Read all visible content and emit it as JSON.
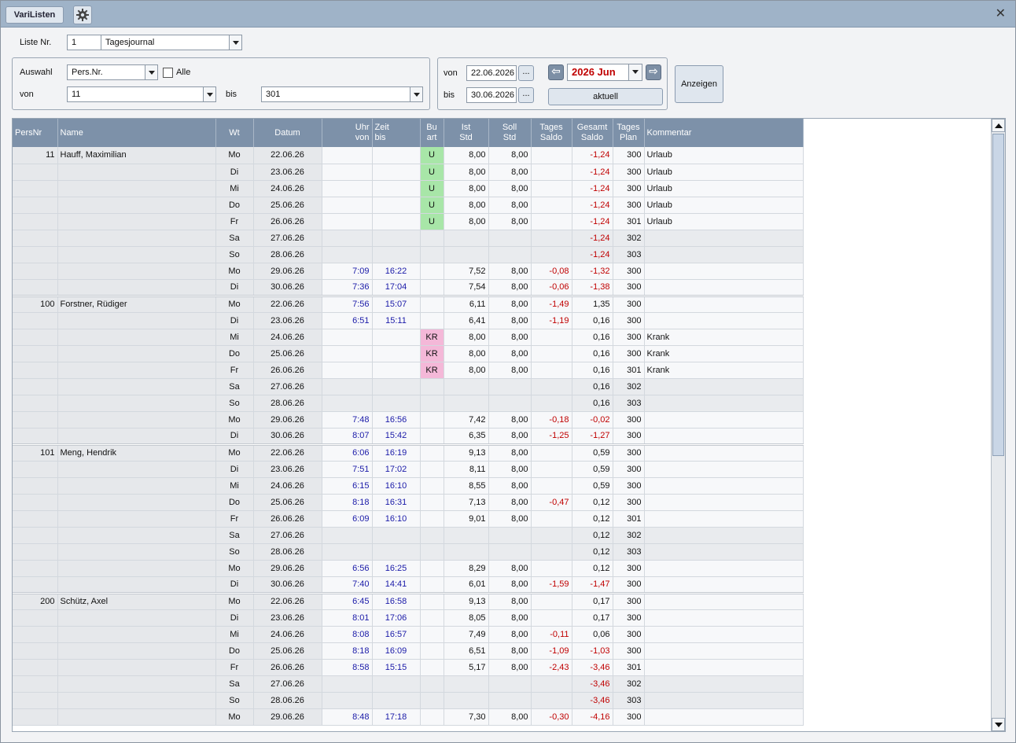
{
  "title_button": "VariListen",
  "icons": {
    "settings": "gear-icon",
    "close": "close-icon",
    "prev": "arrow-left-icon",
    "next": "arrow-right-icon"
  },
  "liste": {
    "label": "Liste Nr.",
    "nr": "1",
    "name": "Tagesjournal"
  },
  "auswahl": {
    "label": "Auswahl",
    "value": "Pers.Nr.",
    "alle_label": "Alle",
    "von_label": "von",
    "von_value": "11",
    "bis_label": "bis",
    "bis_value": "301"
  },
  "zeitraum": {
    "von_label": "von",
    "von_value": "22.06.2026",
    "bis_label": "bis",
    "bis_value": "30.06.2026",
    "ellipsis": "...",
    "month": "2026 Jun",
    "aktuell": "aktuell"
  },
  "anzeigen": "Anzeigen",
  "colors": {
    "titlebar": "#9fb3c8",
    "header": "#7d91a9",
    "urlaub": "#a8e6a8",
    "krank": "#f4b8d8",
    "negative": "#c00000",
    "time": "#1a1aa8"
  },
  "columns": [
    {
      "l1": "PersNr",
      "l2": ""
    },
    {
      "l1": "Name",
      "l2": ""
    },
    {
      "l1": "Wt",
      "l2": ""
    },
    {
      "l1": "Datum",
      "l2": ""
    },
    {
      "l1": "Uhr",
      "l2": "von"
    },
    {
      "l1": "Zeit",
      "l2": "bis"
    },
    {
      "l1": "Bu",
      "l2": "art"
    },
    {
      "l1": "Ist",
      "l2": "Std"
    },
    {
      "l1": "Soll",
      "l2": "Std"
    },
    {
      "l1": "Tages",
      "l2": "Saldo"
    },
    {
      "l1": "Gesamt",
      "l2": "Saldo"
    },
    {
      "l1": "Tages",
      "l2": "Plan"
    },
    {
      "l1": "Kommentar",
      "l2": ""
    }
  ],
  "rows": [
    {
      "pers": "11",
      "name": "Hauff, Maximilian",
      "wt": "Mo",
      "datum": "22.06.26",
      "von": "",
      "bis": "",
      "ba": "U",
      "ist": "8,00",
      "soll": "8,00",
      "ts": "",
      "gs": "-1,24",
      "plan": "300",
      "kom": "Urlaub"
    },
    {
      "pers": "",
      "name": "",
      "wt": "Di",
      "datum": "23.06.26",
      "von": "",
      "bis": "",
      "ba": "U",
      "ist": "8,00",
      "soll": "8,00",
      "ts": "",
      "gs": "-1,24",
      "plan": "300",
      "kom": "Urlaub"
    },
    {
      "pers": "",
      "name": "",
      "wt": "Mi",
      "datum": "24.06.26",
      "von": "",
      "bis": "",
      "ba": "U",
      "ist": "8,00",
      "soll": "8,00",
      "ts": "",
      "gs": "-1,24",
      "plan": "300",
      "kom": "Urlaub"
    },
    {
      "pers": "",
      "name": "",
      "wt": "Do",
      "datum": "25.06.26",
      "von": "",
      "bis": "",
      "ba": "U",
      "ist": "8,00",
      "soll": "8,00",
      "ts": "",
      "gs": "-1,24",
      "plan": "300",
      "kom": "Urlaub"
    },
    {
      "pers": "",
      "name": "",
      "wt": "Fr",
      "datum": "26.06.26",
      "von": "",
      "bis": "",
      "ba": "U",
      "ist": "8,00",
      "soll": "8,00",
      "ts": "",
      "gs": "-1,24",
      "plan": "301",
      "kom": "Urlaub"
    },
    {
      "pers": "",
      "name": "",
      "wt": "Sa",
      "datum": "27.06.26",
      "von": "",
      "bis": "",
      "ba": "",
      "ist": "",
      "soll": "",
      "ts": "",
      "gs": "-1,24",
      "plan": "302",
      "kom": ""
    },
    {
      "pers": "",
      "name": "",
      "wt": "So",
      "datum": "28.06.26",
      "von": "",
      "bis": "",
      "ba": "",
      "ist": "",
      "soll": "",
      "ts": "",
      "gs": "-1,24",
      "plan": "303",
      "kom": ""
    },
    {
      "pers": "",
      "name": "",
      "wt": "Mo",
      "datum": "29.06.26",
      "von": "7:09",
      "bis": "16:22",
      "ba": "",
      "ist": "7,52",
      "soll": "8,00",
      "ts": "-0,08",
      "gs": "-1,32",
      "plan": "300",
      "kom": ""
    },
    {
      "pers": "",
      "name": "",
      "wt": "Di",
      "datum": "30.06.26",
      "von": "7:36",
      "bis": "17:04",
      "ba": "",
      "ist": "7,54",
      "soll": "8,00",
      "ts": "-0,06",
      "gs": "-1,38",
      "plan": "300",
      "kom": ""
    },
    {
      "pers": "100",
      "name": "Forstner, Rüdiger",
      "wt": "Mo",
      "datum": "22.06.26",
      "von": "7:56",
      "bis": "15:07",
      "ba": "",
      "ist": "6,11",
      "soll": "8,00",
      "ts": "-1,49",
      "gs": "1,35",
      "plan": "300",
      "kom": ""
    },
    {
      "pers": "",
      "name": "",
      "wt": "Di",
      "datum": "23.06.26",
      "von": "6:51",
      "bis": "15:11",
      "ba": "",
      "ist": "6,41",
      "soll": "8,00",
      "ts": "-1,19",
      "gs": "0,16",
      "plan": "300",
      "kom": ""
    },
    {
      "pers": "",
      "name": "",
      "wt": "Mi",
      "datum": "24.06.26",
      "von": "",
      "bis": "",
      "ba": "KR",
      "ist": "8,00",
      "soll": "8,00",
      "ts": "",
      "gs": "0,16",
      "plan": "300",
      "kom": "Krank"
    },
    {
      "pers": "",
      "name": "",
      "wt": "Do",
      "datum": "25.06.26",
      "von": "",
      "bis": "",
      "ba": "KR",
      "ist": "8,00",
      "soll": "8,00",
      "ts": "",
      "gs": "0,16",
      "plan": "300",
      "kom": "Krank"
    },
    {
      "pers": "",
      "name": "",
      "wt": "Fr",
      "datum": "26.06.26",
      "von": "",
      "bis": "",
      "ba": "KR",
      "ist": "8,00",
      "soll": "8,00",
      "ts": "",
      "gs": "0,16",
      "plan": "301",
      "kom": "Krank"
    },
    {
      "pers": "",
      "name": "",
      "wt": "Sa",
      "datum": "27.06.26",
      "von": "",
      "bis": "",
      "ba": "",
      "ist": "",
      "soll": "",
      "ts": "",
      "gs": "0,16",
      "plan": "302",
      "kom": ""
    },
    {
      "pers": "",
      "name": "",
      "wt": "So",
      "datum": "28.06.26",
      "von": "",
      "bis": "",
      "ba": "",
      "ist": "",
      "soll": "",
      "ts": "",
      "gs": "0,16",
      "plan": "303",
      "kom": ""
    },
    {
      "pers": "",
      "name": "",
      "wt": "Mo",
      "datum": "29.06.26",
      "von": "7:48",
      "bis": "16:56",
      "ba": "",
      "ist": "7,42",
      "soll": "8,00",
      "ts": "-0,18",
      "gs": "-0,02",
      "plan": "300",
      "kom": ""
    },
    {
      "pers": "",
      "name": "",
      "wt": "Di",
      "datum": "30.06.26",
      "von": "8:07",
      "bis": "15:42",
      "ba": "",
      "ist": "6,35",
      "soll": "8,00",
      "ts": "-1,25",
      "gs": "-1,27",
      "plan": "300",
      "kom": ""
    },
    {
      "pers": "101",
      "name": "Meng, Hendrik",
      "wt": "Mo",
      "datum": "22.06.26",
      "von": "6:06",
      "bis": "16:19",
      "ba": "",
      "ist": "9,13",
      "soll": "8,00",
      "ts": "",
      "gs": "0,59",
      "plan": "300",
      "kom": ""
    },
    {
      "pers": "",
      "name": "",
      "wt": "Di",
      "datum": "23.06.26",
      "von": "7:51",
      "bis": "17:02",
      "ba": "",
      "ist": "8,11",
      "soll": "8,00",
      "ts": "",
      "gs": "0,59",
      "plan": "300",
      "kom": ""
    },
    {
      "pers": "",
      "name": "",
      "wt": "Mi",
      "datum": "24.06.26",
      "von": "6:15",
      "bis": "16:10",
      "ba": "",
      "ist": "8,55",
      "soll": "8,00",
      "ts": "",
      "gs": "0,59",
      "plan": "300",
      "kom": ""
    },
    {
      "pers": "",
      "name": "",
      "wt": "Do",
      "datum": "25.06.26",
      "von": "8:18",
      "bis": "16:31",
      "ba": "",
      "ist": "7,13",
      "soll": "8,00",
      "ts": "-0,47",
      "gs": "0,12",
      "plan": "300",
      "kom": ""
    },
    {
      "pers": "",
      "name": "",
      "wt": "Fr",
      "datum": "26.06.26",
      "von": "6:09",
      "bis": "16:10",
      "ba": "",
      "ist": "9,01",
      "soll": "8,00",
      "ts": "",
      "gs": "0,12",
      "plan": "301",
      "kom": ""
    },
    {
      "pers": "",
      "name": "",
      "wt": "Sa",
      "datum": "27.06.26",
      "von": "",
      "bis": "",
      "ba": "",
      "ist": "",
      "soll": "",
      "ts": "",
      "gs": "0,12",
      "plan": "302",
      "kom": ""
    },
    {
      "pers": "",
      "name": "",
      "wt": "So",
      "datum": "28.06.26",
      "von": "",
      "bis": "",
      "ba": "",
      "ist": "",
      "soll": "",
      "ts": "",
      "gs": "0,12",
      "plan": "303",
      "kom": ""
    },
    {
      "pers": "",
      "name": "",
      "wt": "Mo",
      "datum": "29.06.26",
      "von": "6:56",
      "bis": "16:25",
      "ba": "",
      "ist": "8,29",
      "soll": "8,00",
      "ts": "",
      "gs": "0,12",
      "plan": "300",
      "kom": ""
    },
    {
      "pers": "",
      "name": "",
      "wt": "Di",
      "datum": "30.06.26",
      "von": "7:40",
      "bis": "14:41",
      "ba": "",
      "ist": "6,01",
      "soll": "8,00",
      "ts": "-1,59",
      "gs": "-1,47",
      "plan": "300",
      "kom": ""
    },
    {
      "pers": "200",
      "name": "Schütz, Axel",
      "wt": "Mo",
      "datum": "22.06.26",
      "von": "6:45",
      "bis": "16:58",
      "ba": "",
      "ist": "9,13",
      "soll": "8,00",
      "ts": "",
      "gs": "0,17",
      "plan": "300",
      "kom": ""
    },
    {
      "pers": "",
      "name": "",
      "wt": "Di",
      "datum": "23.06.26",
      "von": "8:01",
      "bis": "17:06",
      "ba": "",
      "ist": "8,05",
      "soll": "8,00",
      "ts": "",
      "gs": "0,17",
      "plan": "300",
      "kom": ""
    },
    {
      "pers": "",
      "name": "",
      "wt": "Mi",
      "datum": "24.06.26",
      "von": "8:08",
      "bis": "16:57",
      "ba": "",
      "ist": "7,49",
      "soll": "8,00",
      "ts": "-0,11",
      "gs": "0,06",
      "plan": "300",
      "kom": ""
    },
    {
      "pers": "",
      "name": "",
      "wt": "Do",
      "datum": "25.06.26",
      "von": "8:18",
      "bis": "16:09",
      "ba": "",
      "ist": "6,51",
      "soll": "8,00",
      "ts": "-1,09",
      "gs": "-1,03",
      "plan": "300",
      "kom": ""
    },
    {
      "pers": "",
      "name": "",
      "wt": "Fr",
      "datum": "26.06.26",
      "von": "8:58",
      "bis": "15:15",
      "ba": "",
      "ist": "5,17",
      "soll": "8,00",
      "ts": "-2,43",
      "gs": "-3,46",
      "plan": "301",
      "kom": ""
    },
    {
      "pers": "",
      "name": "",
      "wt": "Sa",
      "datum": "27.06.26",
      "von": "",
      "bis": "",
      "ba": "",
      "ist": "",
      "soll": "",
      "ts": "",
      "gs": "-3,46",
      "plan": "302",
      "kom": ""
    },
    {
      "pers": "",
      "name": "",
      "wt": "So",
      "datum": "28.06.26",
      "von": "",
      "bis": "",
      "ba": "",
      "ist": "",
      "soll": "",
      "ts": "",
      "gs": "-3,46",
      "plan": "303",
      "kom": ""
    },
    {
      "pers": "",
      "name": "",
      "wt": "Mo",
      "datum": "29.06.26",
      "von": "8:48",
      "bis": "17:18",
      "ba": "",
      "ist": "7,30",
      "soll": "8,00",
      "ts": "-0,30",
      "gs": "-4,16",
      "plan": "300",
      "kom": ""
    }
  ]
}
